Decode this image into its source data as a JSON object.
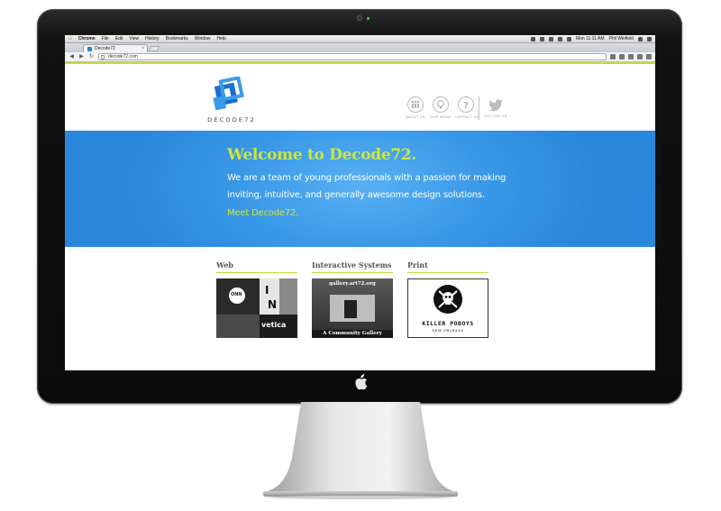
{
  "menubar": {
    "apple": "",
    "items": [
      "Chrome",
      "File",
      "Edit",
      "View",
      "History",
      "Bookmarks",
      "Window",
      "Help"
    ],
    "clock": "Mon 11:11 AM",
    "user": "Phil Winfield"
  },
  "browser": {
    "tab_title": "Decode72",
    "tab_close": "×",
    "url": "decode72.com",
    "back": "◀",
    "forward": "▶",
    "reload": "↻"
  },
  "site": {
    "logo_text": "DECODE72",
    "nav": [
      {
        "label": "ABOUT US",
        "icon": "people-icon"
      },
      {
        "label": "OUR WORK",
        "icon": "lightbulb-icon"
      },
      {
        "label": "CONTACT US",
        "icon": "question-icon"
      },
      {
        "label": "FOLLOW US",
        "icon": "twitter-bird-icon"
      }
    ],
    "hero": {
      "title": "Welcome to Decode72.",
      "line1": "We are a team of young professionals with a passion for making",
      "line2": "inviting, intuitive, and generally awesome design solutions.",
      "link": "Meet Decode72."
    },
    "portfolio": [
      {
        "title": "Web"
      },
      {
        "title": "Interactive Systems",
        "thumb_top": "gallery.art72.org",
        "thumb_caption": "A Community Gallery"
      },
      {
        "title": "Print",
        "thumb_title": "KILLER POBOYS",
        "thumb_sub": "NEW ORLEANS"
      }
    ],
    "web_thumb_text": {
      "a": "ONN",
      "b": "I",
      "c": "N",
      "d": "vetica"
    }
  },
  "colors": {
    "hero_blue": "#3897e6",
    "accent_green": "#c6d93b",
    "hero_title": "#cfe63a"
  }
}
